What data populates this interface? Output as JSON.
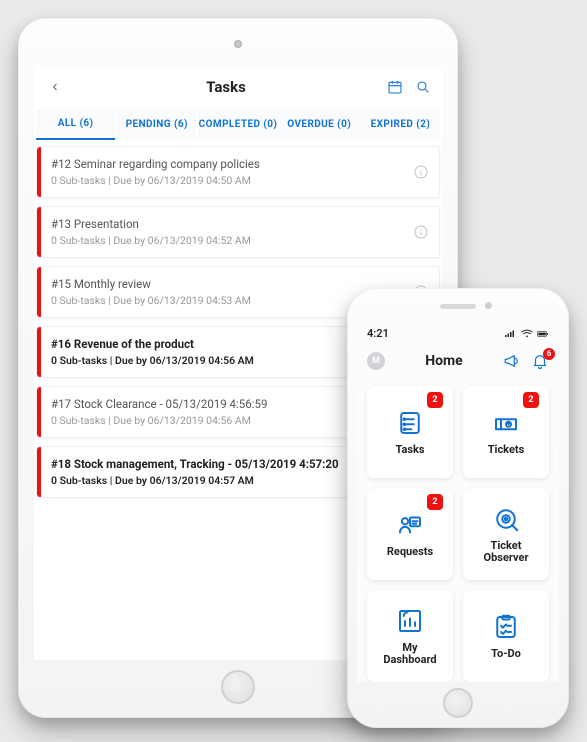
{
  "tablet": {
    "title": "Tasks",
    "tabs": [
      {
        "label": "ALL",
        "count": 6,
        "active": true
      },
      {
        "label": "PENDING",
        "count": 6,
        "active": false
      },
      {
        "label": "COMPLETED",
        "count": 0,
        "active": false
      },
      {
        "label": "OVERDUE",
        "count": 0,
        "active": false
      },
      {
        "label": "EXPIRED",
        "count": 2,
        "active": false
      }
    ],
    "tasks": [
      {
        "title": "#12 Seminar regarding company policies",
        "sub": "0 Sub-tasks | Due by 06/13/2019 04:50 AM",
        "bold": false,
        "info": true
      },
      {
        "title": "#13 Presentation",
        "sub": "0 Sub-tasks | Due by 06/13/2019 04:52 AM",
        "bold": false,
        "info": true
      },
      {
        "title": "#15 Monthly review",
        "sub": "0 Sub-tasks | Due by 06/13/2019 04:53 AM",
        "bold": false,
        "info": true
      },
      {
        "title": "#16 Revenue of the product",
        "sub": "0 Sub-tasks | Due by 06/13/2019 04:56 AM",
        "bold": true,
        "info": false
      },
      {
        "title": "#17 Stock Clearance - 05/13/2019 4:56:59",
        "sub": "0 Sub-tasks | Due by 06/13/2019 04:56 AM",
        "bold": false,
        "info": true
      },
      {
        "title": "#18 Stock management, Tracking - 05/13/2019 4:57:20",
        "sub": "0 Sub-tasks | Due by 06/13/2019 04:57 AM",
        "bold": true,
        "info": false
      }
    ]
  },
  "phone": {
    "status_time": "4:21",
    "avatar": "M",
    "title": "Home",
    "bell_badge": "6",
    "tiles": [
      {
        "label": "Tasks",
        "icon": "tasks",
        "badge": "2"
      },
      {
        "label": "Tickets",
        "icon": "tickets",
        "badge": "2"
      },
      {
        "label": "Requests",
        "icon": "requests",
        "badge": "2"
      },
      {
        "label": "Ticket Observer",
        "icon": "observer",
        "badge": null
      },
      {
        "label": "My Dashboard",
        "icon": "dashboard",
        "badge": null
      },
      {
        "label": "To-Do",
        "icon": "todo",
        "badge": null
      }
    ]
  }
}
